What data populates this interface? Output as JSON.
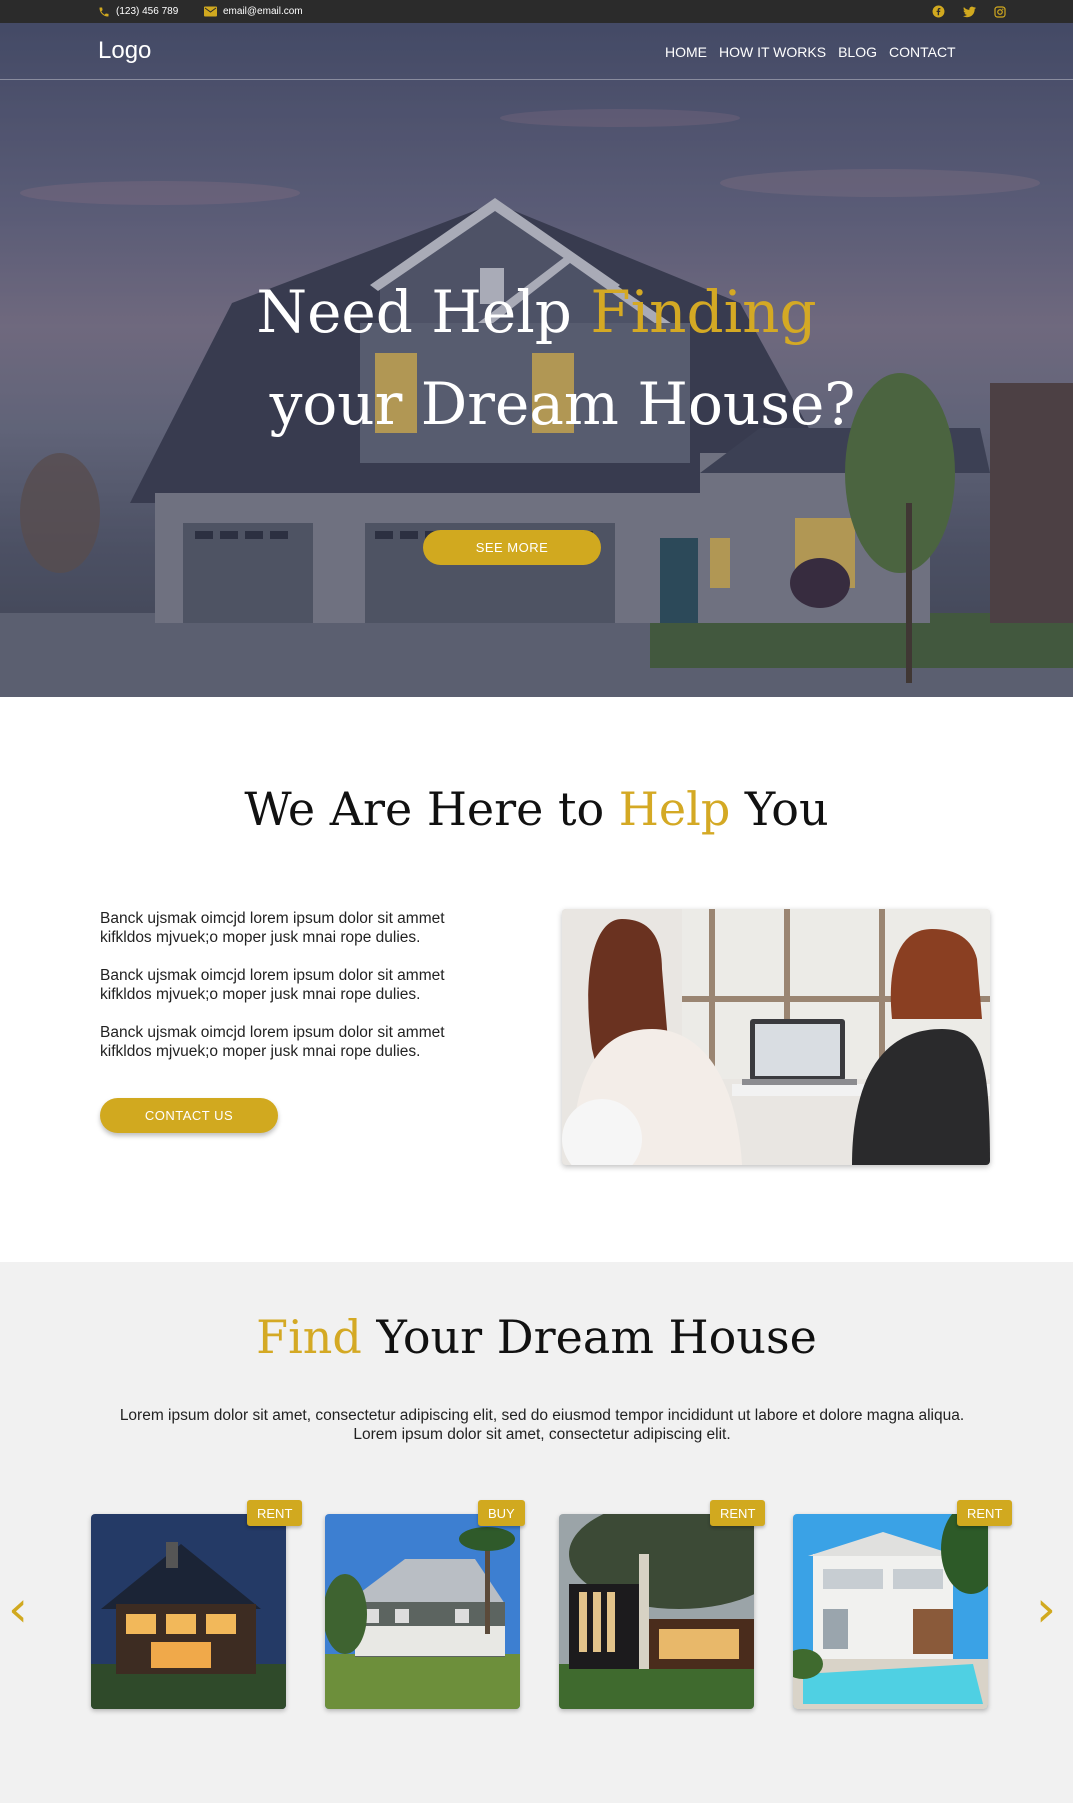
{
  "topbar": {
    "phone": "(123) 456 789",
    "email": "email@email.com",
    "social": [
      "facebook-icon",
      "twitter-icon",
      "instagram-icon"
    ]
  },
  "nav": {
    "logo": "Logo",
    "links": [
      "HOME",
      "HOW IT WORKS",
      "BLOG",
      "CONTACT"
    ]
  },
  "hero": {
    "title_line1_a": "Need Help ",
    "title_line1_b": "Finding",
    "title_line2": "your Dream House?",
    "button": "SEE MORE"
  },
  "help": {
    "title_a": "We Are Here to ",
    "title_b": "Help",
    "title_c": " You",
    "paragraphs": [
      "Banck ujsmak oimcjd lorem ipsum dolor sit ammet kifkldos mjvuek;o moper jusk mnai rope dulies.",
      "Banck ujsmak oimcjd lorem ipsum dolor sit ammet kifkldos mjvuek;o moper jusk mnai rope dulies.",
      "Banck ujsmak oimcjd lorem ipsum dolor sit ammet kifkldos mjvuek;o moper jusk mnai rope dulies."
    ],
    "button": "CONTACT US"
  },
  "listings": {
    "title_a": "Find",
    "title_b": " Your Dream House",
    "description_line1": "Lorem ipsum dolor sit amet, consectetur adipiscing elit, sed do eiusmod tempor incididunt ut labore et dolore magna aliqua.",
    "description_line2": "Lorem ipsum dolor sit amet, consectetur adipiscing elit.",
    "cards": [
      {
        "badge": "RENT"
      },
      {
        "badge": "BUY"
      },
      {
        "badge": "RENT"
      },
      {
        "badge": "RENT"
      }
    ],
    "prev_arrow": "‹",
    "next_arrow": "›"
  },
  "colors": {
    "accent": "#d1a91f",
    "topbar": "#2b2b2b",
    "section_bg": "#f1f1f1"
  }
}
